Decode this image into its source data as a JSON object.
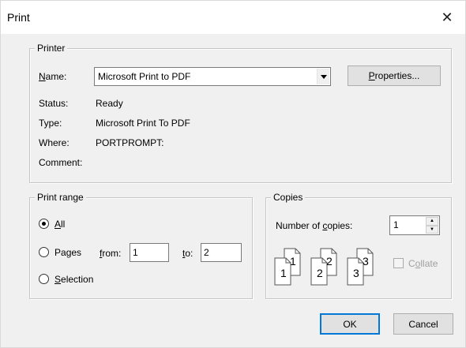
{
  "window": {
    "title": "Print",
    "close_glyph": "✕"
  },
  "printer": {
    "group_label": "Printer",
    "name_label": "Name:",
    "name_value": "Microsoft Print to PDF",
    "properties_button": "Properties...",
    "status_label": "Status:",
    "status_value": "Ready",
    "type_label": "Type:",
    "type_value": "Microsoft Print To PDF",
    "where_label": "Where:",
    "where_value": "PORTPROMPT:",
    "comment_label": "Comment:",
    "comment_value": ""
  },
  "print_range": {
    "group_label": "Print range",
    "all_label": "All",
    "all_checked": true,
    "pages_label": "Pages",
    "pages_checked": false,
    "from_label": "from:",
    "from_value": "1",
    "to_label": "to:",
    "to_value": "2",
    "selection_label": "Selection",
    "selection_checked": false
  },
  "copies": {
    "group_label": "Copies",
    "number_label": "Number of copies:",
    "number_value": "1",
    "collate_label": "Collate",
    "collate_checked": false,
    "collate_enabled": false,
    "sets": [
      {
        "back": "1",
        "front": "1"
      },
      {
        "back": "2",
        "front": "2"
      },
      {
        "back": "3",
        "front": "3"
      }
    ]
  },
  "buttons": {
    "ok": "OK",
    "cancel": "Cancel"
  },
  "icons": {
    "close": "close-icon",
    "dropdown": "chevron-down-icon",
    "spin_up": "spin-up-icon",
    "spin_down": "spin-down-icon",
    "collate_pages": "collate-pages-icon"
  }
}
